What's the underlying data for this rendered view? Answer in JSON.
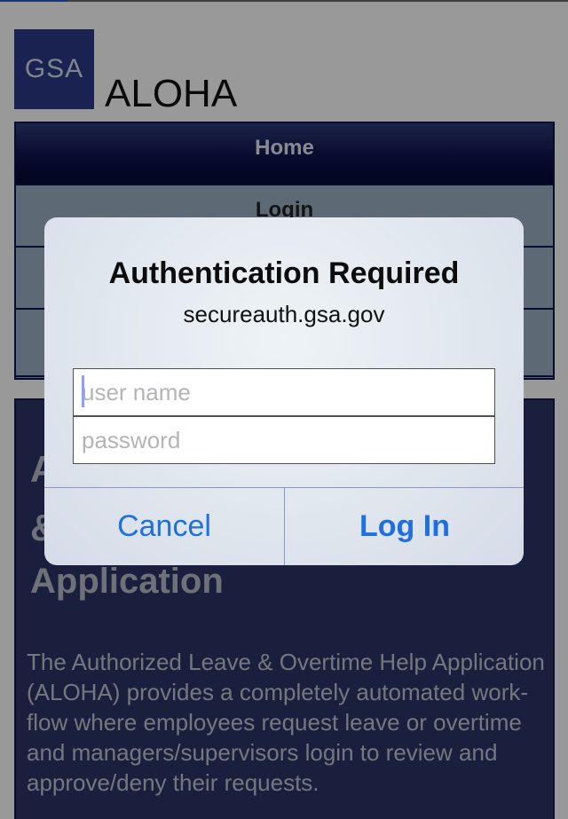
{
  "logo": {
    "text": "GSA"
  },
  "app": {
    "title": "ALOHA"
  },
  "nav": {
    "items": [
      {
        "label": "Home"
      },
      {
        "label": "Login"
      },
      {
        "label": ""
      },
      {
        "label": ""
      }
    ]
  },
  "content": {
    "heading_line1": "A",
    "heading_line2": "&",
    "heading_line3": "Application",
    "body": "The Authorized Leave & Overtime Help Application (ALOHA) provides a completely automated work-flow where employees request leave or overtime and managers/supervisors login to review and approve/deny their requests."
  },
  "dialog": {
    "title": "Authentication Required",
    "host": "secureauth.gsa.gov",
    "username_placeholder": "user name",
    "password_placeholder": "password",
    "cancel_label": "Cancel",
    "login_label": "Log In"
  },
  "colors": {
    "accent": "#1e6fe0",
    "nav_home": "#0b124a",
    "content_bg": "#2e3568",
    "logo_bg": "#2b3a86"
  }
}
